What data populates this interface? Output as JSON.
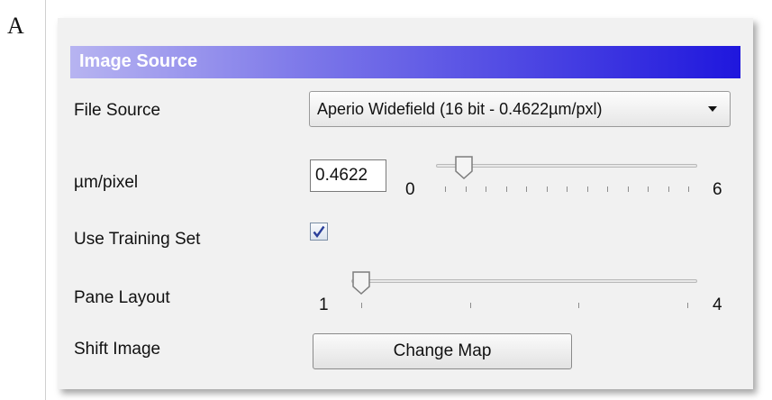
{
  "figure_letter": "A",
  "panel": {
    "title": "Image Source"
  },
  "file_source": {
    "label": "File Source",
    "selected": "Aperio Widefield (16 bit - 0.4622µm/pxl)"
  },
  "um_per_pixel": {
    "label": "µm/pixel",
    "value": "0.4622",
    "slider_min": "0",
    "slider_max": "6",
    "slider_fraction": 0.077
  },
  "use_training_set": {
    "label": "Use Training Set",
    "checked": true
  },
  "pane_layout": {
    "label": "Pane Layout",
    "slider_min": "1",
    "slider_max": "4",
    "slider_value": 1
  },
  "shift_image": {
    "label": "Shift Image",
    "button_label": "Change Map"
  },
  "colors": {
    "title_gradient_start": "#b7b4f1",
    "title_gradient_end": "#1f17dd",
    "panel_background": "#f1f1f1"
  },
  "icons": {
    "dropdown": "chevron-down-icon",
    "checkbox": "checkmark-icon"
  }
}
